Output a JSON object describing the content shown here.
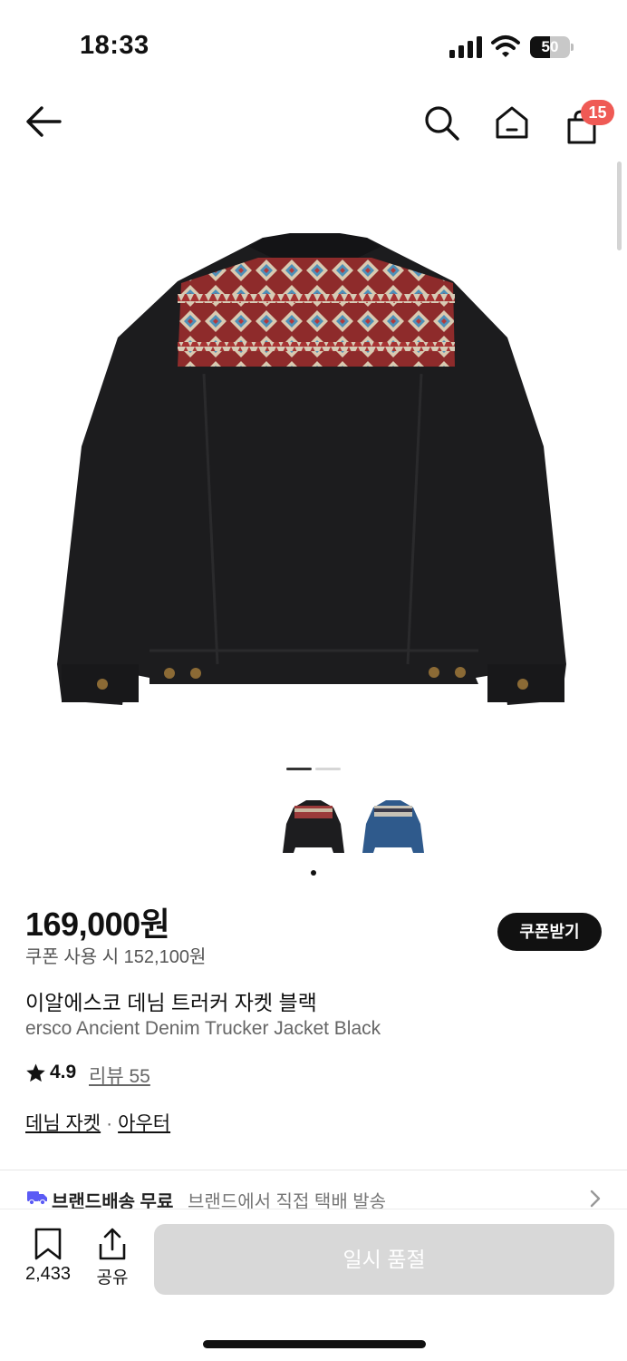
{
  "status_bar": {
    "time": "18:33",
    "battery": "50",
    "battery_level": 0.5
  },
  "nav": {
    "cart_count": "15"
  },
  "gallery": {
    "page_count": 2,
    "current_page": 1,
    "thumbnail_colors": [
      "black",
      "blue"
    ]
  },
  "product": {
    "price": "169,000원",
    "coupon_price": "쿠폰 사용 시 152,100원",
    "coupon_button": "쿠폰받기",
    "name_ko": "이알에스코 데님 트러커 자켓 블랙",
    "name_en": "ersco Ancient Denim Trucker Jacket Black",
    "rating": "4.9",
    "review_link": "리뷰 55",
    "categories": [
      "데님 자켓",
      "아우터"
    ],
    "category_separator": "·"
  },
  "shipping": {
    "title": "브랜드배송 무료",
    "description": "브랜드에서 직접 택배 발송"
  },
  "bottom_bar": {
    "bookmark_count": "2,433",
    "share_label": "공유",
    "soldout_label": "일시 품절"
  },
  "colors": {
    "accent_badge": "#ef5a55",
    "shipping_icon": "#5b5bf5",
    "disabled_button": "#d8d8d8"
  }
}
